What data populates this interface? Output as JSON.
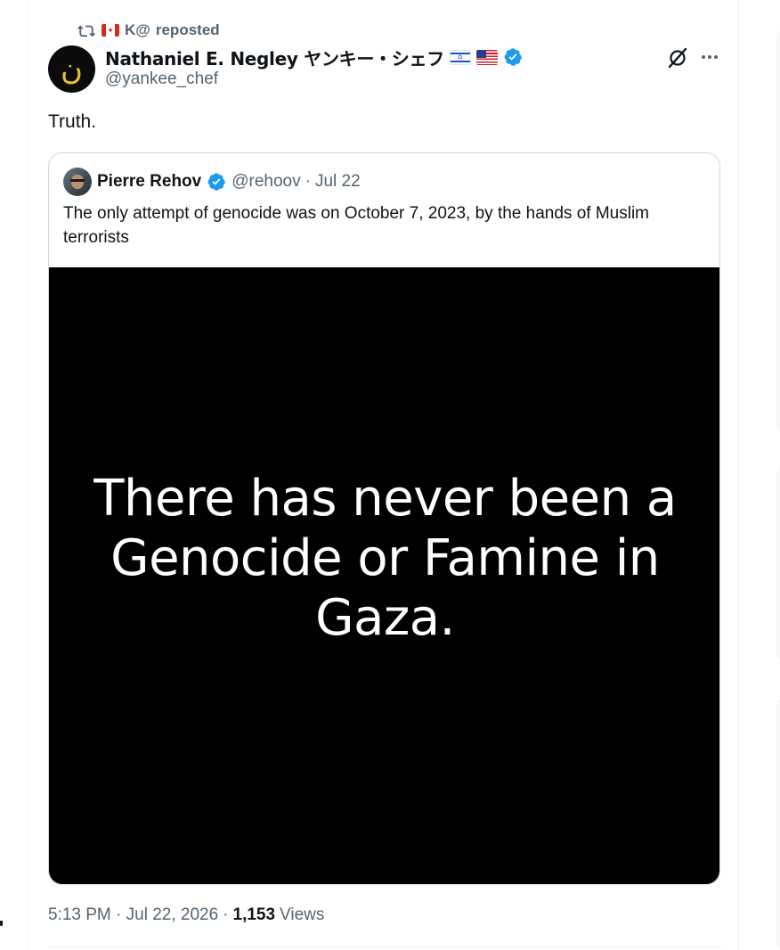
{
  "repost": {
    "icon": "repost-icon",
    "flag": "flag-canada",
    "user": "K@",
    "label": "reposted"
  },
  "tweet": {
    "avatar_icon": "nun-symbol-avatar",
    "display_name": "Nathaniel E. Negley ヤンキー・シェフ",
    "name_flags": [
      "flag-israel",
      "flag-united-states"
    ],
    "verified": true,
    "handle": "@yankee_chef",
    "text": "Truth.",
    "timestamp": "5:13 PM · Jul 22, 2026",
    "sep": "·",
    "views_count": "1,153",
    "views_label": "Views"
  },
  "quote": {
    "display_name": "Pierre Rehov",
    "verified": true,
    "handle": "@rehoov",
    "sep": "·",
    "date": "Jul 22",
    "text": "The only attempt of genocide was on October 7, 2023, by the hands of Muslim terrorists",
    "media_text": "There has never been a Genocide or Famine in Gaza."
  },
  "colors": {
    "text_primary": "#0f1419",
    "text_secondary": "#536471",
    "verified_blue": "#1d9bf0",
    "border": "#cfd9de",
    "media_bg": "#000000"
  }
}
